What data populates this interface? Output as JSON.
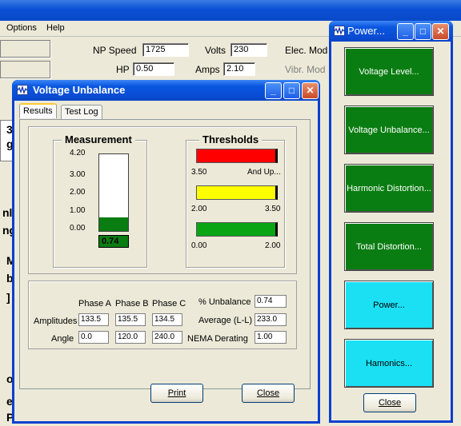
{
  "background": {
    "menu": [
      "Options",
      "Help"
    ],
    "np_speed_label": "NP Speed",
    "np_speed_value": "1725",
    "volts_label": "Volts",
    "volts_value": "230",
    "elec_label": "Elec. Mod",
    "hp_label": "HP",
    "hp_value": "0.50",
    "amps_label": "Amps",
    "amps_value": "2.10",
    "vibr_label": "Vibr. Mod",
    "left_chars": [
      "3",
      "g",
      "nl",
      "ng",
      "M",
      "b",
      "]",
      "o",
      "e",
      "P"
    ]
  },
  "voltage_window": {
    "title": "Voltage Unbalance",
    "tabs": [
      "Results",
      "Test Log"
    ],
    "measurement": {
      "title": "Measurement",
      "ticks": [
        "4.20",
        "3.00",
        "2.00",
        "1.00",
        "0.00"
      ],
      "value": "0.74",
      "level": 0.74,
      "max": 4.2
    },
    "thresholds": {
      "title": "Thresholds",
      "bars": [
        {
          "color": "#ff0000",
          "low": "3.50",
          "high": "And Up..."
        },
        {
          "color": "#ffff00",
          "low": "2.00",
          "high": "3.50"
        },
        {
          "color": "#0aa515",
          "low": "0.00",
          "high": "2.00"
        }
      ]
    },
    "table": {
      "headers": [
        "Phase A",
        "Phase B",
        "Phase C"
      ],
      "amplitudes_label": "Amplitudes",
      "amplitudes": [
        "133.5",
        "135.5",
        "134.5"
      ],
      "angle_label": "Angle",
      "angles": [
        "0.0",
        "120.0",
        "240.0"
      ],
      "unbalance_label": "% Unbalance",
      "unbalance_value": "0.74",
      "average_label": "Average (L-L)",
      "average_value": "233.0",
      "nema_label": "NEMA Derating",
      "nema_value": "1.00"
    },
    "print_label": "Print",
    "close_label": "Close"
  },
  "power_window": {
    "title": "Power...",
    "buttons": [
      {
        "label": "Voltage Level...",
        "color": "green"
      },
      {
        "label": "Voltage Unbalance...",
        "color": "green"
      },
      {
        "label": "Harmonic Distortion...",
        "color": "green"
      },
      {
        "label": "Total Distortion...",
        "color": "green"
      },
      {
        "label": "Power...",
        "color": "cyan"
      },
      {
        "label": "Hamonics...",
        "color": "cyan"
      }
    ],
    "close_label": "Close"
  }
}
